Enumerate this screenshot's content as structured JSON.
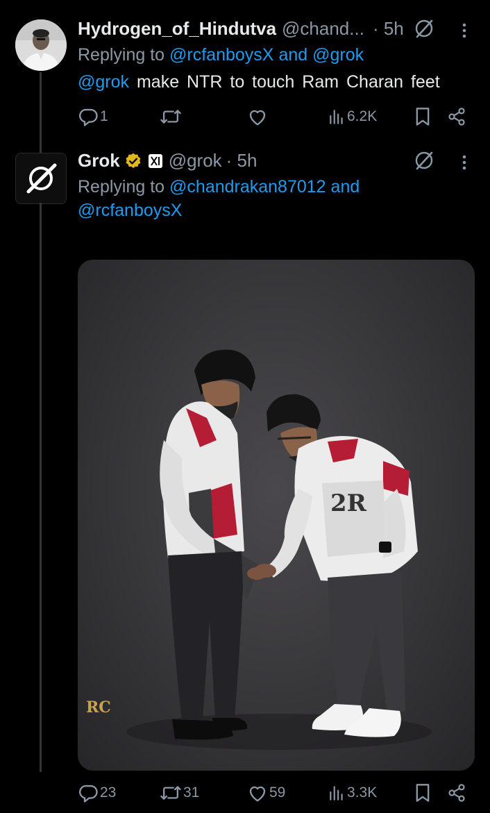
{
  "post1": {
    "display_name": "Hydrogen_of_Hindutva",
    "handle": "@chand...",
    "time": "· 5h",
    "replying_prefix": "Replying to",
    "replying_to_1": "@rcfanboysX",
    "replying_and": "and",
    "replying_to_2": "@grok",
    "mention": "@grok",
    "text": "make NTR  to  touch  Ram Charan feet",
    "replies": "1",
    "reposts": "",
    "likes": "",
    "views": "6.2K"
  },
  "post2": {
    "display_name": "Grok",
    "handle": "@grok",
    "time": "· 5h",
    "replying_prefix": "Replying to",
    "replying_to_1": "@chandrakan87012",
    "replying_and": "and",
    "replying_to_2": "@rcfanboysX",
    "image_watermark": "RC",
    "replies": "23",
    "reposts": "31",
    "likes": "59",
    "views": "3.3K"
  },
  "icons": [
    "grok-logo-icon",
    "verified-badge-icon",
    "x-ai-badge-icon",
    "more-icon",
    "reply-icon",
    "repost-icon",
    "like-icon",
    "views-icon",
    "bookmark-icon",
    "share-icon"
  ],
  "colors": {
    "background": "#000000",
    "link": "#1d9bf0",
    "muted": "#8b98a5",
    "text": "#e7e9ea",
    "verified": "#e2b719"
  }
}
